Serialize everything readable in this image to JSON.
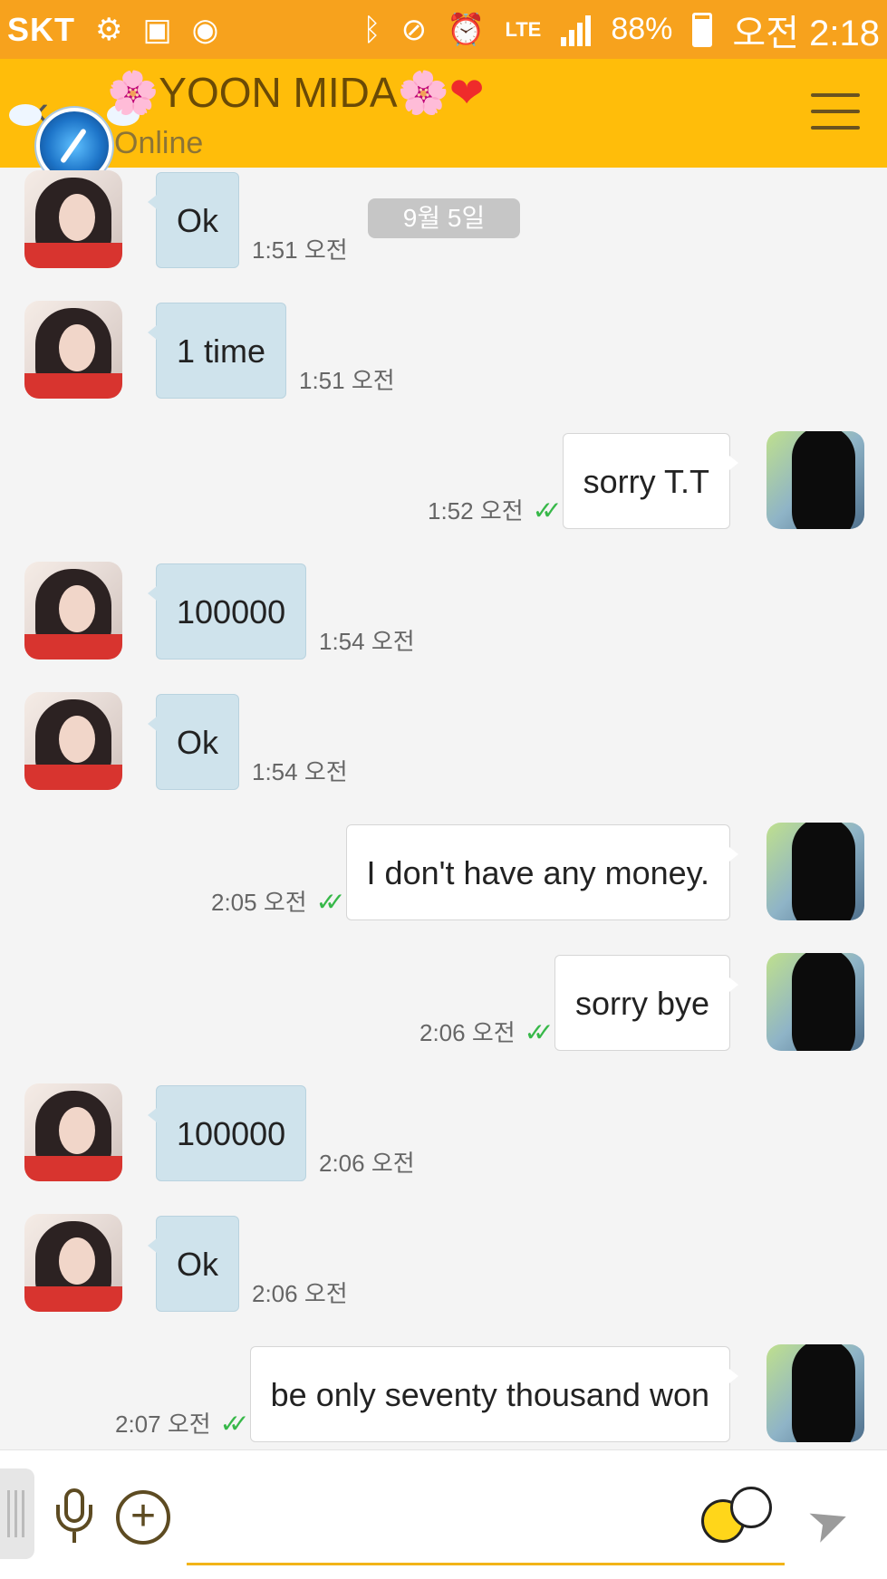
{
  "status_bar": {
    "carrier": "SKT",
    "battery": "88%",
    "network": "LTE",
    "time": "오전 2:18",
    "icons": [
      "usb-debug-icon",
      "image-icon",
      "app-icon",
      "bluetooth-icon",
      "mute-icon",
      "alarm-icon",
      "signal-icon",
      "battery-icon"
    ]
  },
  "header": {
    "title": "YOON MIDA",
    "title_prefix": "🌸",
    "title_suffix": "🌸",
    "title_heart": "❤",
    "status": "Online"
  },
  "date_chip": "9월 5일",
  "messages": [
    {
      "from": "other",
      "text": "Ok",
      "time": "1:51 오전"
    },
    {
      "from": "other",
      "text": "1 time",
      "time": "1:51 오전"
    },
    {
      "from": "me",
      "text": "sorry    T.T",
      "time": "1:52 오전",
      "read": true
    },
    {
      "from": "other",
      "text": "100000",
      "time": "1:54 오전"
    },
    {
      "from": "other",
      "text": "Ok",
      "time": "1:54 오전"
    },
    {
      "from": "me",
      "text": "I don't have any money.",
      "time": "2:05 오전",
      "read": true
    },
    {
      "from": "me",
      "text": "sorry  bye",
      "time": "2:06 오전",
      "read": true
    },
    {
      "from": "other",
      "text": "100000",
      "time": "2:06 오전"
    },
    {
      "from": "other",
      "text": "Ok",
      "time": "2:06 오전"
    },
    {
      "from": "me",
      "text": "be only seventy thousand won",
      "time": "2:07 오전",
      "read": true
    }
  ],
  "input": {
    "placeholder": "",
    "value": ""
  },
  "colors": {
    "status_bar": "#f7a21d",
    "header": "#ffbd0a",
    "other_bubble": "#cfe3ec",
    "my_bubble": "#ffffff",
    "read_ticks": "#37b849"
  }
}
